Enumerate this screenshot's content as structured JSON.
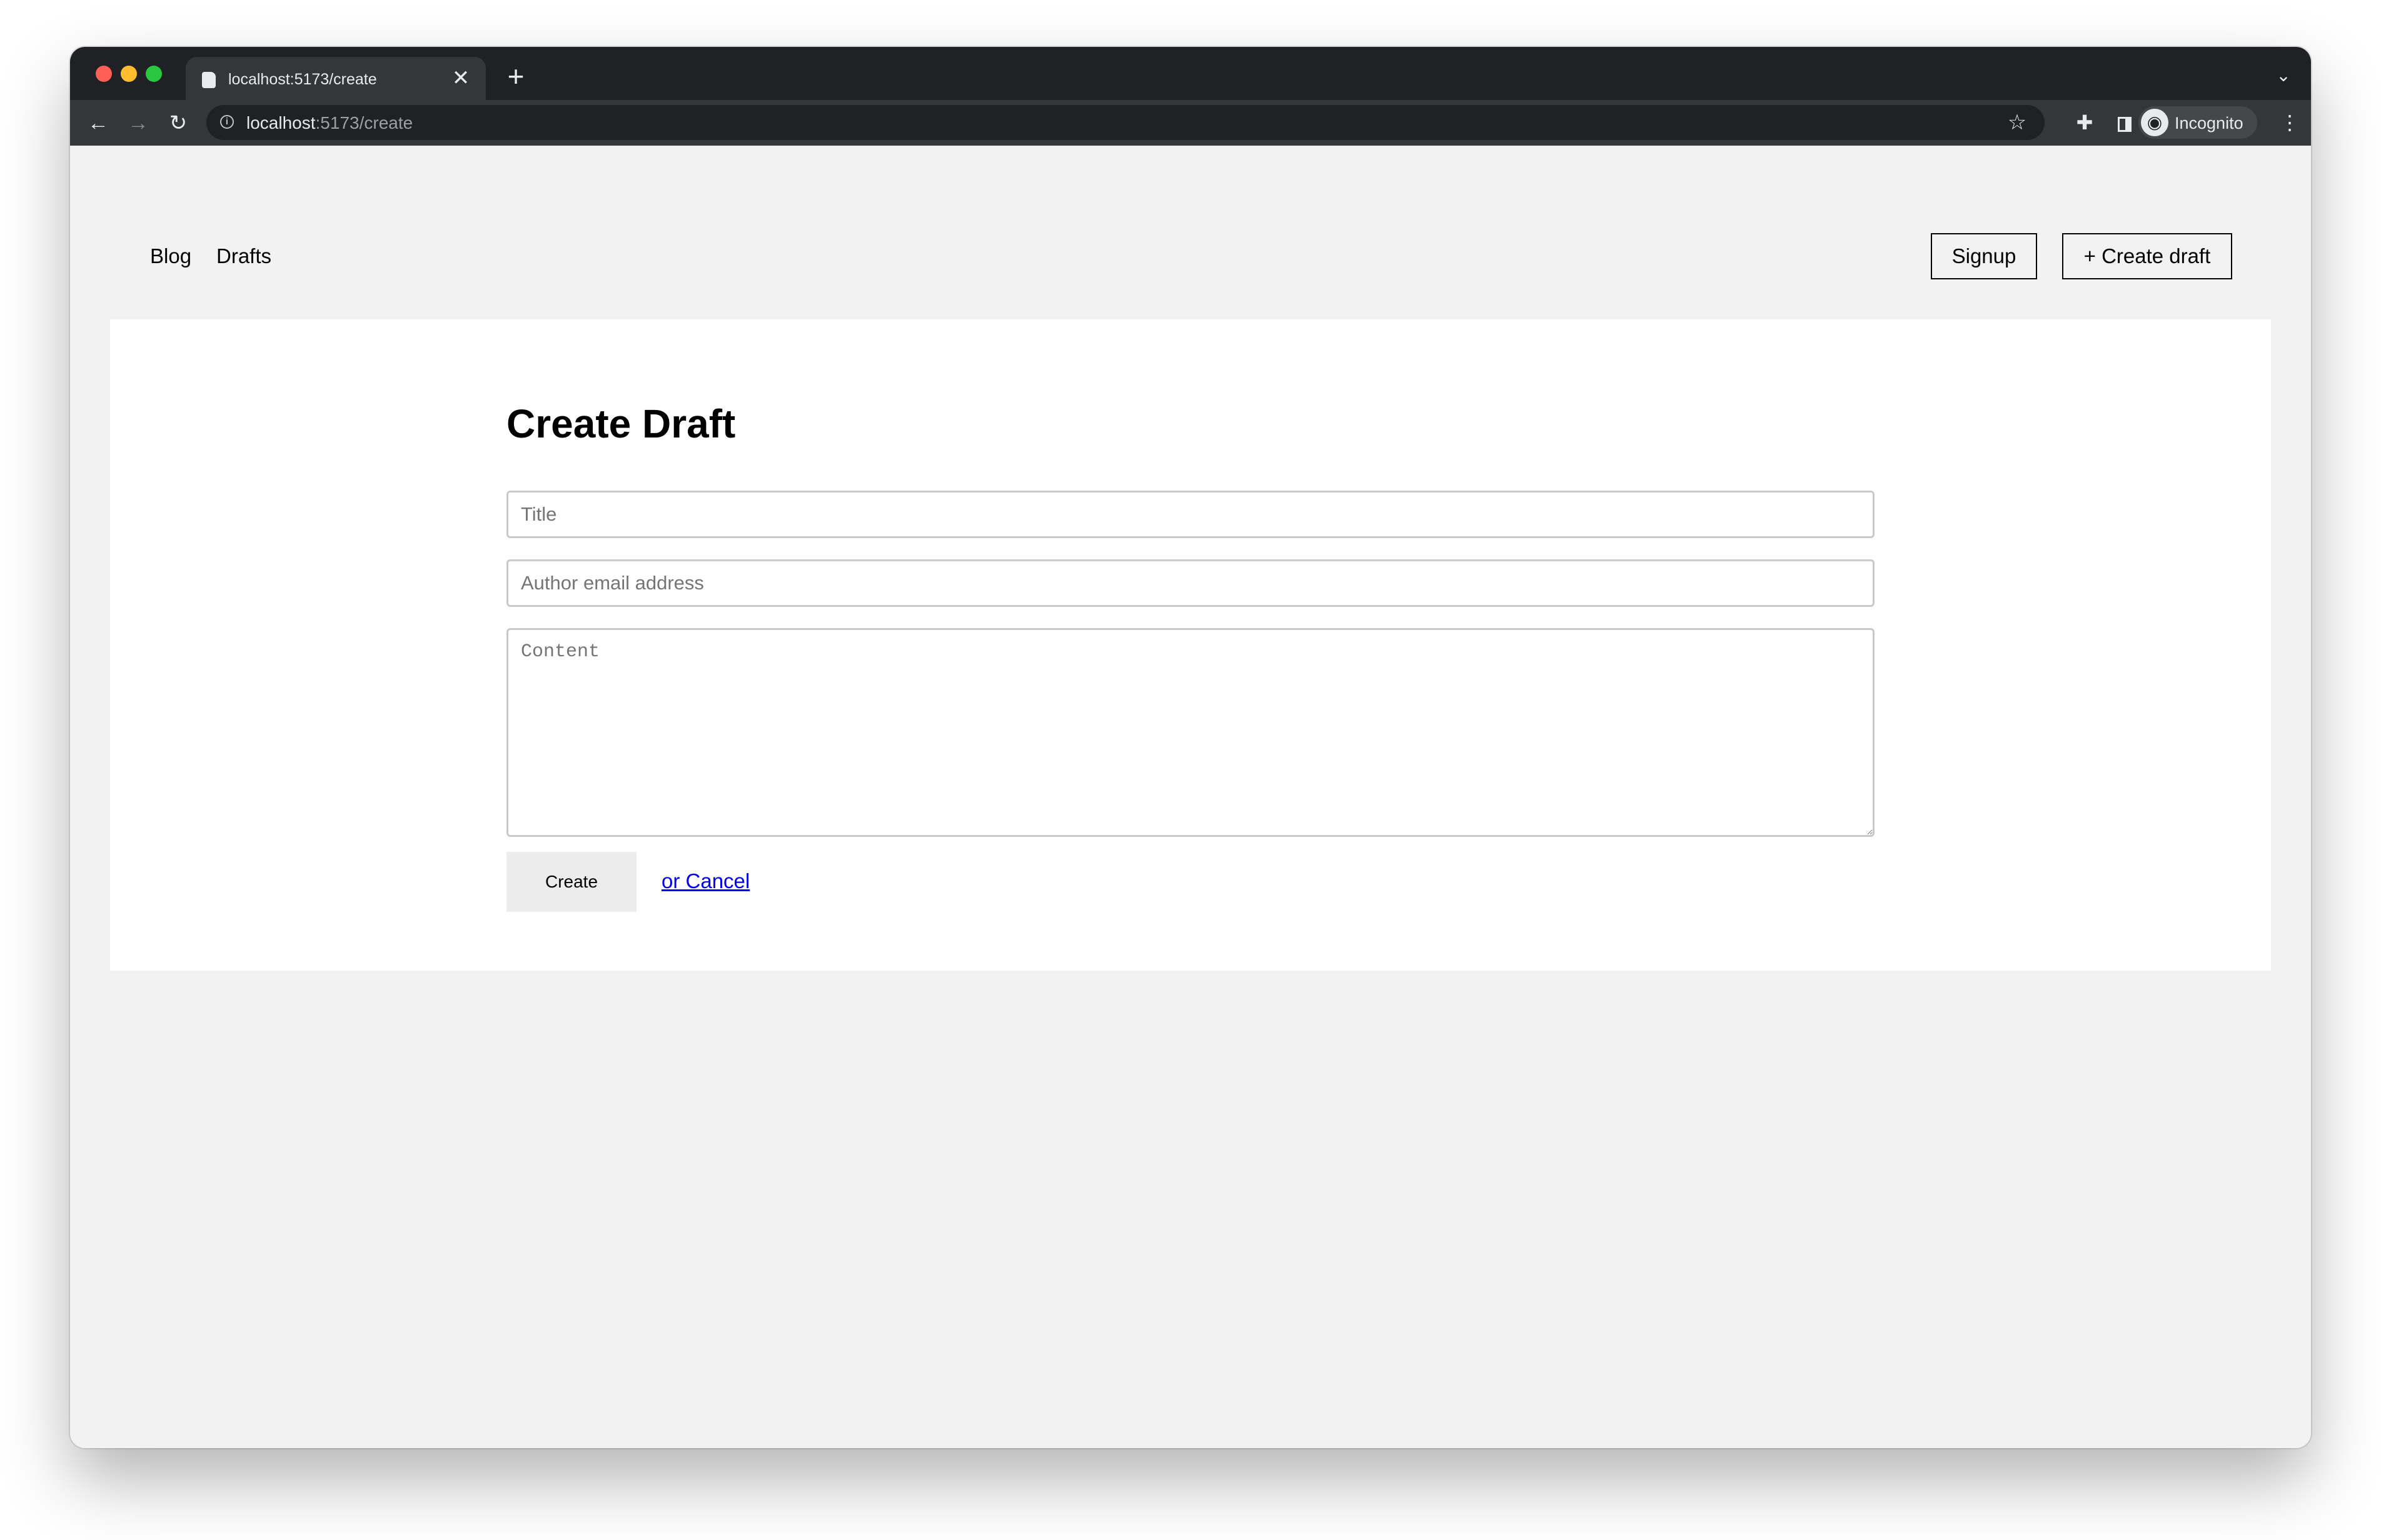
{
  "browser": {
    "tab": {
      "title": "localhost:5173/create",
      "close_symbol": "✕"
    },
    "new_tab_symbol": "+",
    "tab_search_symbol": "⌄",
    "toolbar": {
      "back_symbol": "←",
      "forward_symbol": "→",
      "reload_symbol": "↻",
      "info_symbol": "i",
      "url_host": "localhost",
      "url_path": ":5173/create",
      "star_symbol": "☆",
      "extensions_symbol": "✚",
      "profile_label": "Incognito",
      "avatar_symbol": "◉",
      "menu_symbol": "⋮"
    }
  },
  "nav": {
    "blog": "Blog",
    "drafts": "Drafts",
    "signup": "Signup",
    "create_draft": "+ Create draft"
  },
  "form": {
    "heading": "Create Draft",
    "title_placeholder": "Title",
    "email_placeholder": "Author email address",
    "content_placeholder": "Content",
    "submit_label": "Create",
    "cancel_label": "or Cancel"
  },
  "icons": [
    "favicon-icon",
    "close-icon",
    "plus-icon",
    "chevron-down-icon",
    "back-arrow-icon",
    "forward-arrow-icon",
    "reload-icon",
    "info-icon",
    "star-icon",
    "extensions-icon",
    "side-panel-icon",
    "incognito-icon",
    "more-icon"
  ]
}
